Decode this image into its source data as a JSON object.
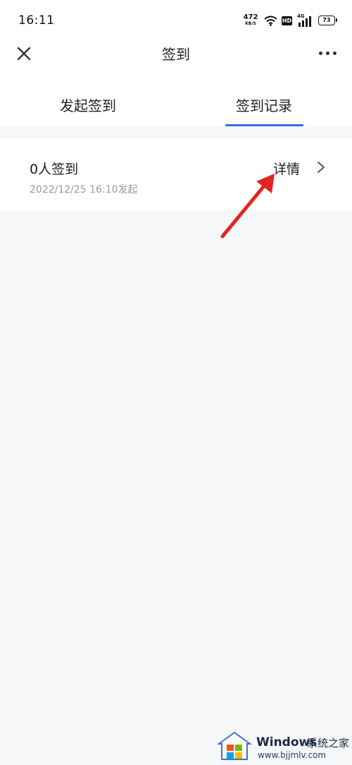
{
  "status_bar": {
    "time": "16:11",
    "net_speed_value": "472",
    "net_speed_unit": "KB/S",
    "hd_label": "HD",
    "network_label": "4G",
    "battery": "73"
  },
  "nav": {
    "title": "签到",
    "close_icon": "close-icon",
    "more_icon": "more-icon"
  },
  "tabs": [
    {
      "label": "发起签到",
      "active": false
    },
    {
      "label": "签到记录",
      "active": true
    }
  ],
  "accent_color": "#2f6fe0",
  "records": [
    {
      "title": "0人签到",
      "time": "2022/12/25 16:10发起",
      "detail_label": "详情"
    }
  ],
  "watermark": {
    "brand": "Windows",
    "cn_text": "系统之家",
    "url": "www.bjjmlv.com"
  }
}
